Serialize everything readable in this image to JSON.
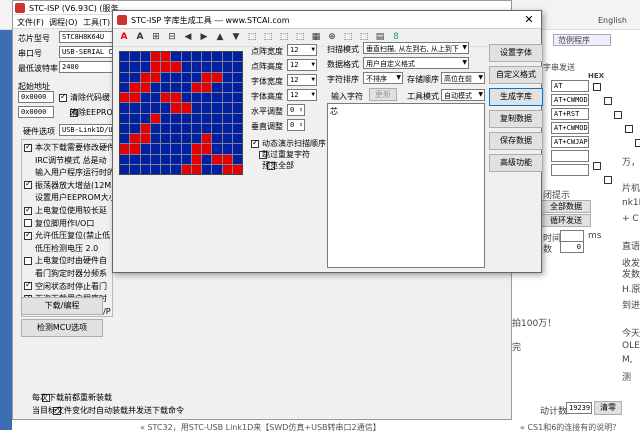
{
  "background": {
    "right_lines": [
      "万，",
      "片机",
      "nk1D",
      "+ C",
      "直语",
      "收发",
      "发数",
      "H.原",
      "到进",
      "今天",
      "OLE",
      "M,",
      "测"
    ],
    "bottom_left_text": "« STC32，用STC-USB Link1D来【SWD仿真+USB转串口2通信】",
    "bottom_right_text": "« CS1和6的连接有的说明？",
    "middle_text_a": "拍100万！",
    "middle_text_b": "完",
    "counter_label": "动计数",
    "counter_value": "19239",
    "clear_label": "清零",
    "tab_right": "范例程序",
    "send_label": "字串发送",
    "hex_label": "HEX",
    "side_fields": [
      "AT",
      "AT+CWMODE",
      "AT+RST",
      "AT+CWMODE",
      "AT+CWJAP",
      "",
      ""
    ],
    "side_misc": [
      "闭提示",
      "全部数据",
      "循环发送",
      "时间",
      "数",
      "ms",
      "0"
    ],
    "english_label": "English"
  },
  "isp": {
    "title": "STC-ISP (V6.93C) (服务",
    "menus": [
      "文件(F)",
      "调程(O)",
      "工具(T)",
      "帮助(H)"
    ],
    "chip_label": "芯片型号",
    "chip_value": "STC8H8K64U",
    "port_label": "串口号",
    "port_value": "USB-SERIAL CH",
    "baud_label": "最低波特率",
    "baud_value": "2400",
    "start_label": "起始地址",
    "addr1": "0x0000",
    "addr2": "0x0000",
    "clear_code": "清除代码缓",
    "clear_eeprom": "清除EEPROM缓",
    "hw_label": "硬件选项",
    "hw_value": "USB-Link1D/U8",
    "options": [
      {
        "label": "本次下载需要修改硬件",
        "checked": true
      },
      {
        "label": "IRC调节模式  总是动",
        "checked": false
      },
      {
        "label": "输入用户程序运行时的IR",
        "checked": false
      },
      {
        "label": "振荡器放大增益(12MH",
        "checked": true
      },
      {
        "label": "设置用户EEPROM大小",
        "checked": false
      },
      {
        "label": "上电复位使用较长延",
        "checked": true
      },
      {
        "label": "复位脚用作I/O口",
        "checked": false
      },
      {
        "label": "允许低压复位(禁止低",
        "checked": true
      },
      {
        "label": "低压检测电压    2.0",
        "checked": false
      },
      {
        "label": "上电复位时由硬件自",
        "checked": false
      },
      {
        "label": "看门狗定时器分频系",
        "checked": false
      },
      {
        "label": "空闲状态时停止看门",
        "checked": true
      },
      {
        "label": "下次下载用户程序时",
        "checked": true
      },
      {
        "label": "下次冷启动时,P3.2/P",
        "checked": false
      }
    ],
    "download_btn": "下载/编程",
    "check_btn": "检测MCU选项",
    "bottom_opts": [
      "每次下载前都重新装载",
      "当目标文件变化时自动装载并发送下载命令"
    ]
  },
  "dialog": {
    "title": "STC-ISP 字库生成工具 --- www.STCAI.com",
    "toolbar": [
      "A",
      "A",
      "⊞",
      "⊟",
      "◀",
      "▶",
      "▲",
      "▼",
      "⬚",
      "⬚",
      "⬚",
      "⬚",
      "▦",
      "⊕",
      "⬚",
      "⬚",
      "▤",
      "8"
    ],
    "grid_rows": [
      "000110000000",
      "000111000000",
      "001100001100",
      "011000011000",
      "110011000000",
      "000001100000",
      "000100000000",
      "001000000000",
      "011000001000",
      "110000011000",
      "000000010110",
      "000000110011"
    ],
    "params": [
      {
        "label": "点阵宽度",
        "value": "12"
      },
      {
        "label": "点阵高度",
        "value": "12"
      },
      {
        "label": "字体宽度",
        "value": "12"
      },
      {
        "label": "字体高度",
        "value": "12"
      },
      {
        "label": "水平调整",
        "value": "0"
      },
      {
        "label": "垂直调整",
        "value": "0"
      }
    ],
    "mode_rows": [
      {
        "label": "扫描模式",
        "value": "垂直扫描, 从左到右, 从上到下"
      },
      {
        "label": "数据格式",
        "value": "用户自定义格式"
      },
      {
        "label": "字符排序",
        "value": "不排序"
      }
    ],
    "store_label": "存储顺序",
    "store_value": "高位在前",
    "input_label": "输入字符",
    "update_btn": "更新",
    "tool_mode_label": "工具模式",
    "tool_mode_value": "自动模式",
    "input_text": "芯",
    "checks": [
      {
        "label": "动态演示扫描顺序",
        "checked": true
      },
      {
        "label": "跳过重复字符",
        "checked": false
      },
      {
        "label": "预览全部",
        "checked": false
      }
    ],
    "buttons": [
      "设置字体",
      "自定义格式",
      "生成字库",
      "复制数据",
      "保存数据",
      "高级功能"
    ]
  }
}
